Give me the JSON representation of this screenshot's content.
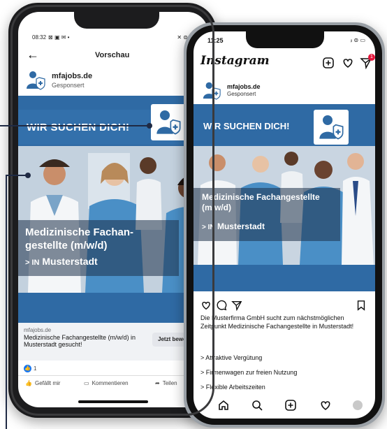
{
  "facebook": {
    "status_time": "08:32",
    "status_icons": "⊠ ▣ ✉ •",
    "status_right": "✕ ⊜ ᵢₗ 97%",
    "header_title": "Vorschau",
    "page_name": "mfajobs.de",
    "sponsored": "Gesponsert",
    "banner": "WIR SUCHEN DICH!",
    "job_title": "Medizinische Fachan-gestellte (m/w/d)",
    "loc_prefix": "> IN",
    "location": "Musterstadt",
    "link_domain": "mfajobs.de",
    "link_title": "Medizinische Fachangestellte (m/w/d) in Musterstadt gesucht!",
    "cta": "Jetzt bewerben",
    "like_count": "1",
    "action_like": "Gefällt mir",
    "action_comment": "Kommentieren",
    "action_share": "Teilen"
  },
  "instagram": {
    "status_time": "11:25",
    "status_right": "ᵢₗ ⊜ ▭",
    "app_name": "Instagram",
    "caret": "⌄",
    "badge": "1",
    "page_name": "mfajobs.de",
    "sponsored": "Gesponsert",
    "banner": "WIR SUCHEN DICH!",
    "job_title": "Medizinische Fachangestellte (m/w/d)",
    "loc_prefix": "> IN",
    "location": "Musterstadt",
    "caption": "Die Musterfirma GmbH sucht zum nächstmöglichen Zeitpunkt Medizinische Fachangestellte in Musterstadt!",
    "bullets": [
      "> Attraktive Vergütung",
      "> Firmenwagen zur freien Nutzung",
      "> Flexible Arbeitszeiten"
    ]
  },
  "colors": {
    "brand_blue": "#2f6aa4",
    "fb_blue": "#1877f2",
    "connector": "#1f2a44"
  }
}
